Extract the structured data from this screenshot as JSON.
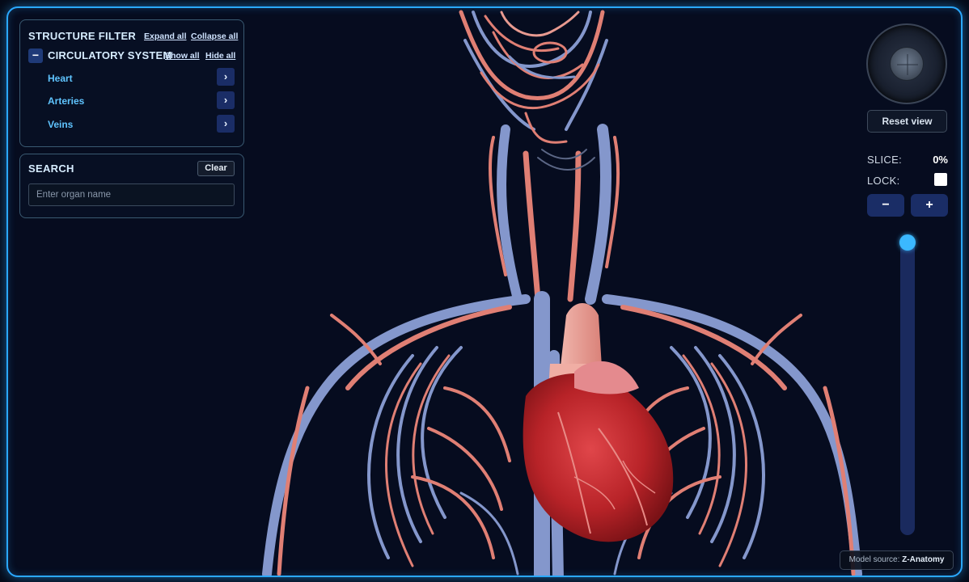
{
  "filter": {
    "title": "STRUCTURE FILTER",
    "expand_all": "Expand all",
    "collapse_all": "Collapse all",
    "system": {
      "collapse_symbol": "−",
      "title": "CIRCULATORY SYSTEM",
      "show_all": "Show all",
      "hide_all": "Hide all",
      "items": [
        {
          "label": "Heart",
          "chevron": "›"
        },
        {
          "label": "Arteries",
          "chevron": "›"
        },
        {
          "label": "Veins",
          "chevron": "›"
        }
      ]
    }
  },
  "search": {
    "title": "SEARCH",
    "clear_label": "Clear",
    "placeholder": "Enter organ name",
    "value": ""
  },
  "controls": {
    "reset_label": "Reset view",
    "slice_label": "SLICE:",
    "slice_value": "0%",
    "slice_fraction": 0,
    "lock_label": "LOCK:",
    "lock_checked": false,
    "minus_label": "−",
    "plus_label": "+"
  },
  "credit": {
    "prefix": "Model source: ",
    "source": "Z-Anatomy"
  },
  "colors": {
    "frame_glow": "#2aa8ff",
    "artery": "#e8857a",
    "vein": "#8397cc",
    "heart": "#c42a30",
    "accent_blue": "#5fc4ff",
    "button_navy": "#1a2d66"
  }
}
